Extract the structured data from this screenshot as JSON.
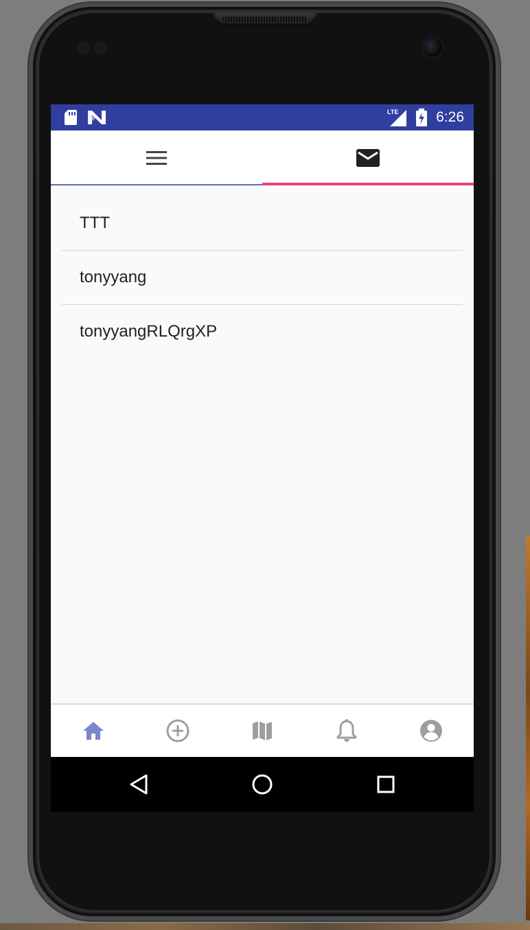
{
  "status_bar": {
    "time": "6:26",
    "network_label": "LTE",
    "color": "#303f9f",
    "left_icons": [
      "sd-card-icon",
      "n-notification-icon"
    ],
    "right_icons": [
      "lte-signal-icon",
      "battery-charging-icon"
    ]
  },
  "tabs": [
    {
      "icon": "menu-icon",
      "selected": false,
      "indicator_color": "#5c6bc0"
    },
    {
      "icon": "mail-icon",
      "selected": true,
      "indicator_color": "#ec407a"
    }
  ],
  "list": {
    "items": [
      {
        "label": "TTT"
      },
      {
        "label": "tonyyang"
      },
      {
        "label": "tonyyangRLQrgXP"
      }
    ]
  },
  "bottom_nav": {
    "active_color": "#7986cb",
    "inactive_color": "#9e9e9e",
    "items": [
      {
        "icon": "home-icon",
        "active": true
      },
      {
        "icon": "add-circle-icon",
        "active": false
      },
      {
        "icon": "map-icon",
        "active": false
      },
      {
        "icon": "bell-icon",
        "active": false
      },
      {
        "icon": "account-icon",
        "active": false
      }
    ]
  },
  "system_nav": {
    "buttons": [
      "back-icon",
      "home-circle-icon",
      "recents-icon"
    ]
  }
}
